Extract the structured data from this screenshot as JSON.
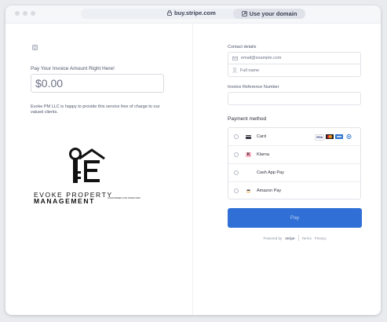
{
  "browser": {
    "url": "buy.stripe.com",
    "domain_button": "Use your domain"
  },
  "left": {
    "amount_label": "Pay Your Invoice Amount Right Here!",
    "amount_value": "$0.00",
    "description": "Evoke PM LLC is happy to provide this service free of charge to our valued clients.",
    "logo": {
      "line1": "EVOKE PROPERTY",
      "line2": "MANAGEMENT",
      "tagline": "CONFORMED FOR INVESTORS"
    }
  },
  "right": {
    "contact_title": "Contact details",
    "email_placeholder": "email@example.com",
    "name_placeholder": "Full name",
    "reference_label": "Invoice Reference Number",
    "reference_value": "",
    "payment_title": "Payment method",
    "payment_methods": [
      {
        "label": "Card",
        "icon": "card-icon"
      },
      {
        "label": "Klarna",
        "icon": "klarna-icon"
      },
      {
        "label": "Cash App Pay",
        "icon": "cashapp-icon"
      },
      {
        "label": "Amazon Pay",
        "icon": "amazon-icon"
      }
    ],
    "card_brands": [
      "VISA",
      "MC",
      "AMEX",
      "DISC"
    ],
    "pay_button": "Pay",
    "footer": {
      "powered": "Powered by",
      "brand": "stripe",
      "terms": "Terms",
      "privacy": "Privacy"
    }
  },
  "colors": {
    "accent": "#2f6fd6",
    "pay_text": "#b9cff5"
  }
}
